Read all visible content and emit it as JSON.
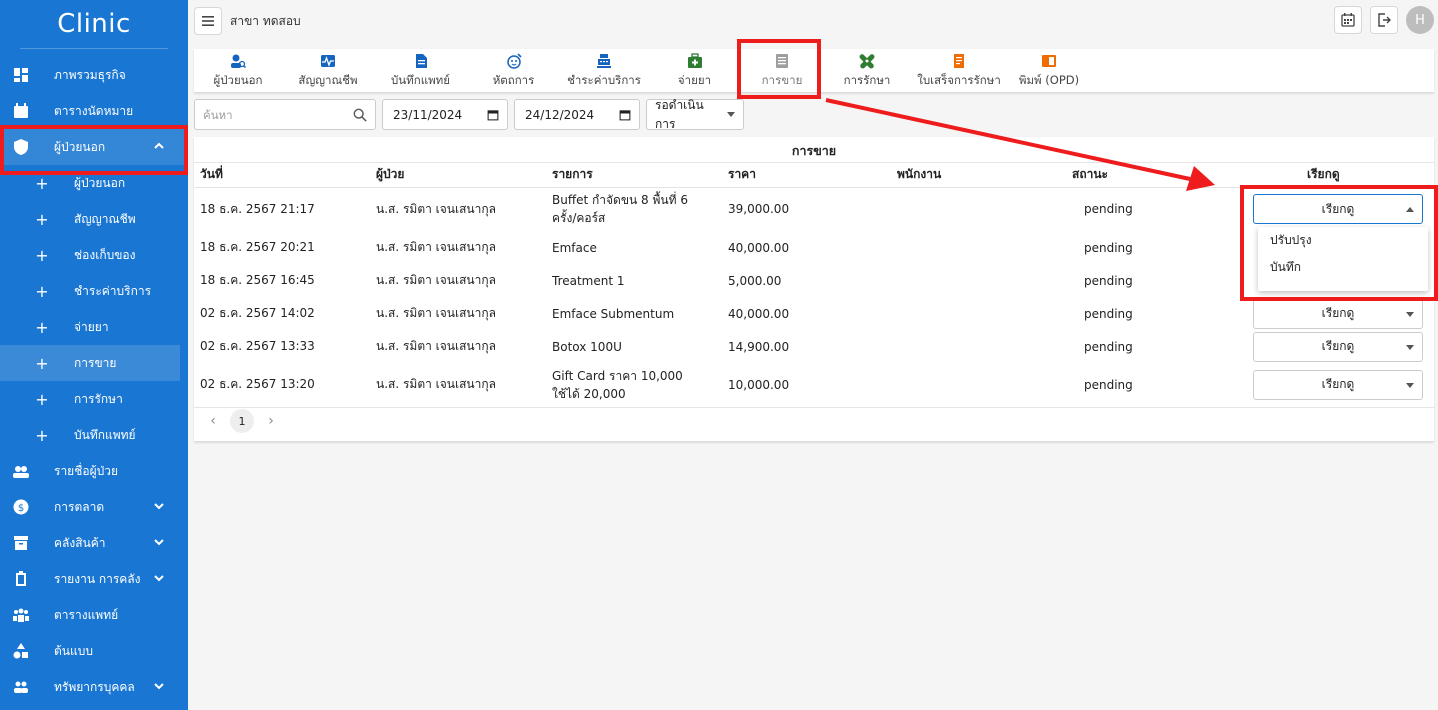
{
  "sidebar": {
    "brand": "Clinic",
    "items": [
      {
        "label": "ภาพรวมธุรกิจ",
        "icon": "dashboard-icon"
      },
      {
        "label": "ตารางนัดหมาย",
        "icon": "calendar-icon"
      },
      {
        "label": "ผู้ป่วยนอก",
        "icon": "shield-icon",
        "expanded": true
      }
    ],
    "subitems": [
      {
        "label": "ผู้ป่วยนอก"
      },
      {
        "label": "สัญญาณชีพ"
      },
      {
        "label": "ช่องเก็บของ"
      },
      {
        "label": "ชำระค่าบริการ"
      },
      {
        "label": "จ่ายยา"
      },
      {
        "label": "การขาย",
        "active": true
      },
      {
        "label": "การรักษา"
      },
      {
        "label": "บันทึกแพทย์"
      }
    ],
    "items2": [
      {
        "label": "รายชื่อผู้ป่วย",
        "icon": "patients-icon"
      },
      {
        "label": "การตลาด",
        "icon": "dollar-icon"
      },
      {
        "label": "คลังสินค้า",
        "icon": "archive-icon"
      },
      {
        "label": "รายงาน การคลัง",
        "icon": "clipboard-icon"
      },
      {
        "label": "ตารางแพทย์",
        "icon": "doctors-icon"
      },
      {
        "label": "ต้นแบบ",
        "icon": "shapes-icon"
      },
      {
        "label": "ทรัพยากรบุคคล",
        "icon": "people-icon"
      }
    ]
  },
  "topbar": {
    "branch": "สาขา ทดสอบ",
    "avatar": "H"
  },
  "tabs": [
    {
      "label": "ผู้ป่วยนอก",
      "icon": "patient-search-icon",
      "color": "#1565c0"
    },
    {
      "label": "สัญญาณชีพ",
      "icon": "vital-signs-icon",
      "color": "#1565c0"
    },
    {
      "label": "บันทึกแพทย์",
      "icon": "document-icon",
      "color": "#1565c0"
    },
    {
      "label": "หัตถการ",
      "icon": "procedure-icon",
      "color": "#1565c0"
    },
    {
      "label": "ชำระค่าบริการ",
      "icon": "cash-register-icon",
      "color": "#1565c0"
    },
    {
      "label": "จ่ายยา",
      "icon": "medical-kit-icon",
      "color": "#2e7d32"
    },
    {
      "label": "การขาย",
      "icon": "list-icon",
      "color": "#9e9e9e",
      "current": true
    },
    {
      "label": "การรักษา",
      "icon": "bandage-icon",
      "color": "#2e7d32"
    },
    {
      "label": "ใบเสร็จการรักษา",
      "icon": "receipt-icon",
      "color": "#ef6c00"
    },
    {
      "label": "พิมพ์ (OPD)",
      "icon": "print-icon",
      "color": "#ef6c00"
    }
  ],
  "filters": {
    "search_placeholder": "ค้นหา",
    "date_from": "23/11/2024",
    "date_to": "24/12/2024",
    "status": "รอดำเนินการ"
  },
  "table": {
    "title": "การขาย",
    "columns": [
      "วันที่",
      "ผู้ป่วย",
      "รายการ",
      "ราคา",
      "พนักงาน",
      "สถานะ",
      "เรียกดู"
    ],
    "rows": [
      {
        "date": "18 ธ.ค. 2567 21:17",
        "patient": "น.ส. รมิตา เจนเสนากุล",
        "item": "Buffet กำจัดขน 8 พื้นที่ 6 ครั้ง/คอร์ส",
        "price": "39,000.00",
        "staff": "",
        "status": "pending",
        "action": "เรียกดู"
      },
      {
        "date": "18 ธ.ค. 2567 20:21",
        "patient": "น.ส. รมิตา เจนเสนากุล",
        "item": "Emface",
        "price": "40,000.00",
        "staff": "",
        "status": "pending",
        "action": "เรียกดู"
      },
      {
        "date": "18 ธ.ค. 2567 16:45",
        "patient": "น.ส. รมิตา เจนเสนากุล",
        "item": "Treatment 1",
        "price": "5,000.00",
        "staff": "",
        "status": "pending",
        "action": "เรียกดู"
      },
      {
        "date": "02 ธ.ค. 2567 14:02",
        "patient": "น.ส. รมิตา เจนเสนากุล",
        "item": "Emface Submentum",
        "price": "40,000.00",
        "staff": "",
        "status": "pending",
        "action": "เรียกดู"
      },
      {
        "date": "02 ธ.ค. 2567 13:33",
        "patient": "น.ส. รมิตา เจนเสนากุล",
        "item": "Botox 100U",
        "price": "14,900.00",
        "staff": "",
        "status": "pending",
        "action": "เรียกดู"
      },
      {
        "date": "02 ธ.ค. 2567 13:20",
        "patient": "น.ส. รมิตา เจนเสนากุล",
        "item": "Gift Card ราคา 10,000 ใช้ได้ 20,000",
        "price": "10,000.00",
        "staff": "",
        "status": "pending",
        "action": "เรียกดู"
      }
    ],
    "dropdown_options": [
      "ปรับปรุง",
      "บันทึก"
    ],
    "page": "1"
  },
  "colors": {
    "sidebar": "#1976d2",
    "annotation": "#ee1c1c"
  }
}
